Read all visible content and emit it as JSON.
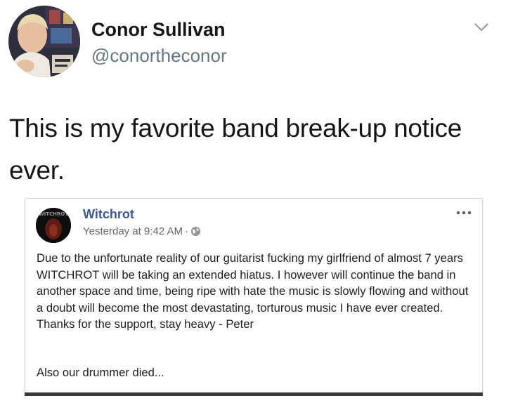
{
  "tweet": {
    "author": {
      "display_name": "Conor Sullivan",
      "handle": "@conortheconor"
    },
    "menu_icon": "chevron-down-icon",
    "text": "This is my favorite band break-up notice ever.",
    "quoted_post": {
      "page_name": "Witchrot",
      "avatar_text": "WITCHROT",
      "timestamp": "Yesterday at 9:42 AM",
      "separator": "·",
      "audience_icon": "globe-icon",
      "options_icon": "more-options-icon",
      "body": "Due to the unfortunate reality of our guitarist fucking my girlfriend of almost 7 years WITCHROT will be taking an extended hiatus. I however will continue the band in another space and time, being ripe with hate the music is slowly flowing and without a doubt will become the most devastating, torturous music I have ever created. Thanks for the support, stay heavy - Peter",
      "footer": "Also our drummer died..."
    }
  }
}
